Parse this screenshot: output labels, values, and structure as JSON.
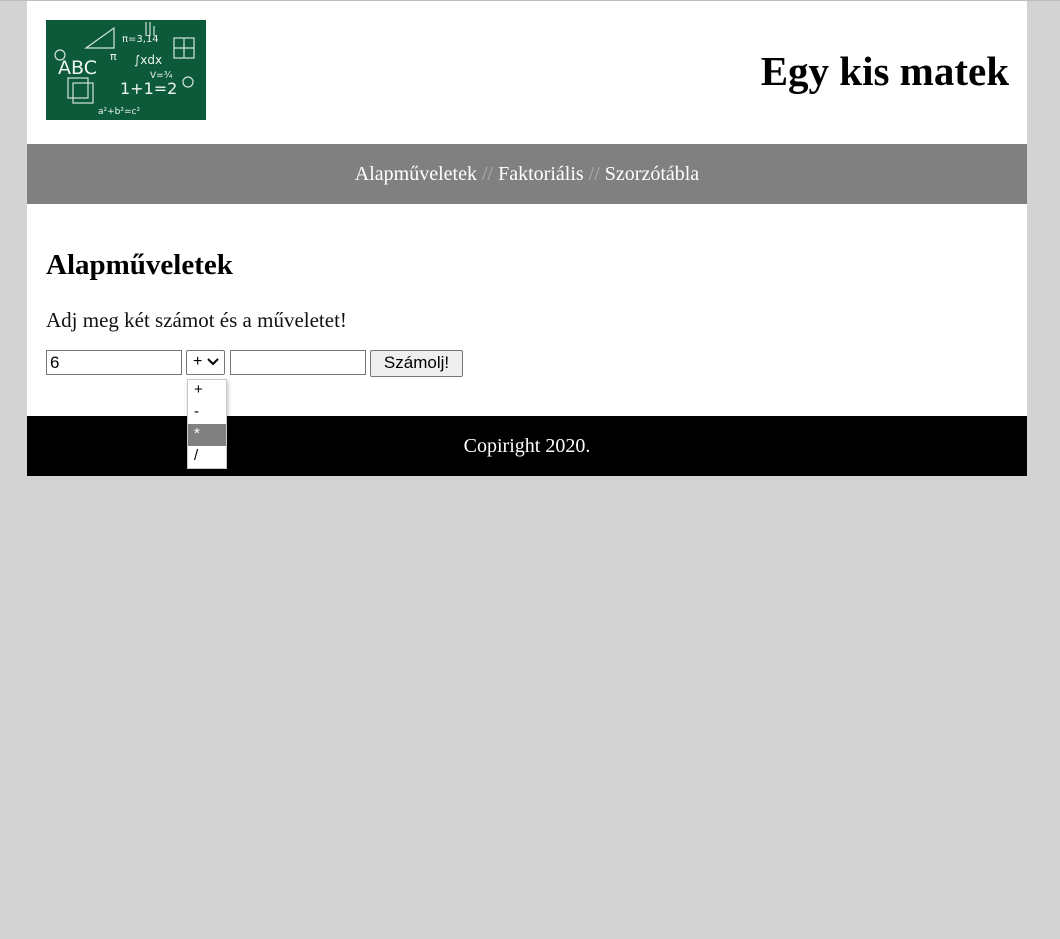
{
  "header": {
    "logo_text": [
      "ABC",
      "1+1=2",
      "π=3,14",
      "∫xdx",
      "a²+b²=c²",
      "V=¾",
      "π"
    ],
    "title": "Egy kis matek"
  },
  "nav": {
    "items": [
      "Alapműveletek",
      "Faktoriális",
      "Szorzótábla"
    ],
    "separator": "//"
  },
  "main": {
    "heading": "Alapműveletek",
    "instruction": "Adj meg két számot és a műveletet!",
    "form": {
      "first_number": "6",
      "operator": "+",
      "second_number": "",
      "submit_label": "Számolj!"
    }
  },
  "dropdown": {
    "options": [
      "+",
      "-",
      "*",
      "/"
    ],
    "highlighted": "*"
  },
  "footer": {
    "text": "Copiright 2020."
  },
  "colors": {
    "background": "#d3d3d3",
    "nav_bg": "#808080",
    "footer_bg": "#000000",
    "highlight": "#808080",
    "chalkboard": "#0c5a3a"
  }
}
